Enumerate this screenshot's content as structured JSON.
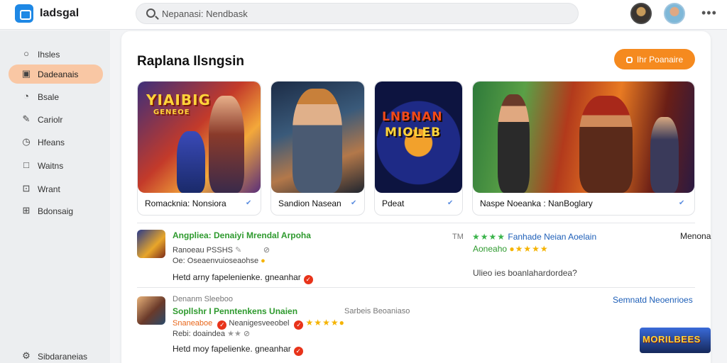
{
  "app": {
    "name": "Iadsgal",
    "logo_icon": "app-logo-icon",
    "brand_color": "#1e88e5"
  },
  "search": {
    "placeholder": "Nepanasi: Nendbask"
  },
  "header": {
    "more_label": "•••"
  },
  "sidebar": {
    "items": [
      {
        "label": "Ihsles",
        "icon": "search-icon"
      },
      {
        "label": "Dadeanais",
        "icon": "dashboard-icon",
        "active": true
      },
      {
        "label": "Bsale",
        "icon": "tag-icon"
      },
      {
        "label": "Cariolr",
        "icon": "edit-icon"
      },
      {
        "label": "Hfeans",
        "icon": "history-icon"
      },
      {
        "label": "Waitns",
        "icon": "square-icon"
      },
      {
        "label": "Wrant",
        "icon": "calendar-icon"
      },
      {
        "label": "Bdonsaig",
        "icon": "chart-icon"
      }
    ],
    "footer": {
      "label": "Sibdaraneias",
      "icon": "settings-icon"
    },
    "accent_color": "#f9c7a4"
  },
  "main": {
    "title": "Raplana Ilsngsin",
    "cta": {
      "label": "Ihr Poanaire",
      "color": "#f58a1f"
    },
    "featured": [
      {
        "caption": "Romacknia: Nonsiora",
        "art_title": "YIAIBIG",
        "art_sub": "GENEOE"
      },
      {
        "caption": "Sandion Nasean"
      },
      {
        "caption": "Pdeat",
        "art_title": "LNBNAN",
        "art_sub": "MIOLEB"
      },
      {
        "caption": "Naspe Noeanka : NanBoglary"
      }
    ],
    "listings": [
      {
        "title": "Angpliea: Denaiyi Mrendal Arpoha",
        "sub1": "Ranoeau PSSHS",
        "sub2": "Oe: Oseaenvuioseaohse",
        "line": "Hetd arny fapelenienke. gneanhar",
        "meta_left": "TM",
        "right_title": "Fanhade Neian Aoelain",
        "right_sub": "Aoneaho",
        "right_line": "Ulieo ies boanlahardordea?",
        "right_top": "Menona"
      },
      {
        "title": "Sopllshr I Penntenkens Unaien",
        "kicker": "Denanm Sleeboo",
        "sub1": "Snaneaboe",
        "sub1b": "Neanigesveeobel",
        "sub2": "Rebi: doaindea",
        "line": "Hetd moy fapelienke. gneanhar",
        "mid": "Sarbeis Beoaniaso",
        "right_top": "Semnatd Neoenrioes",
        "promo_text": "MORILBEES"
      }
    ]
  }
}
